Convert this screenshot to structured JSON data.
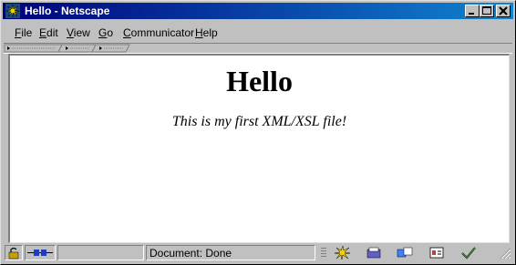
{
  "window": {
    "title": "Hello - Netscape"
  },
  "menubar": {
    "items": [
      {
        "accel": "F",
        "rest": "ile"
      },
      {
        "accel": "E",
        "rest": "dit"
      },
      {
        "accel": "V",
        "rest": "iew"
      },
      {
        "accel": "G",
        "rest": "o"
      },
      {
        "accel": "C",
        "rest": "ommunicator"
      },
      {
        "accel": "H",
        "rest": "elp"
      }
    ]
  },
  "page": {
    "heading": "Hello",
    "subtitle": "This is my first XML/XSL file!"
  },
  "statusbar": {
    "text": "Document: Done"
  },
  "colors": {
    "titlebar_start": "#00007b",
    "titlebar_end": "#1084d0",
    "chrome": "#c0c0c0"
  },
  "icons": {
    "titlebar": "netscape-logo-icon",
    "status_left": [
      "lock-icon",
      "connection-icon"
    ],
    "status_right": [
      "navigator-icon",
      "mailbox-icon",
      "discussion-icon",
      "composer-icon",
      "checkmark-icon",
      "resize-grip-icon"
    ]
  }
}
